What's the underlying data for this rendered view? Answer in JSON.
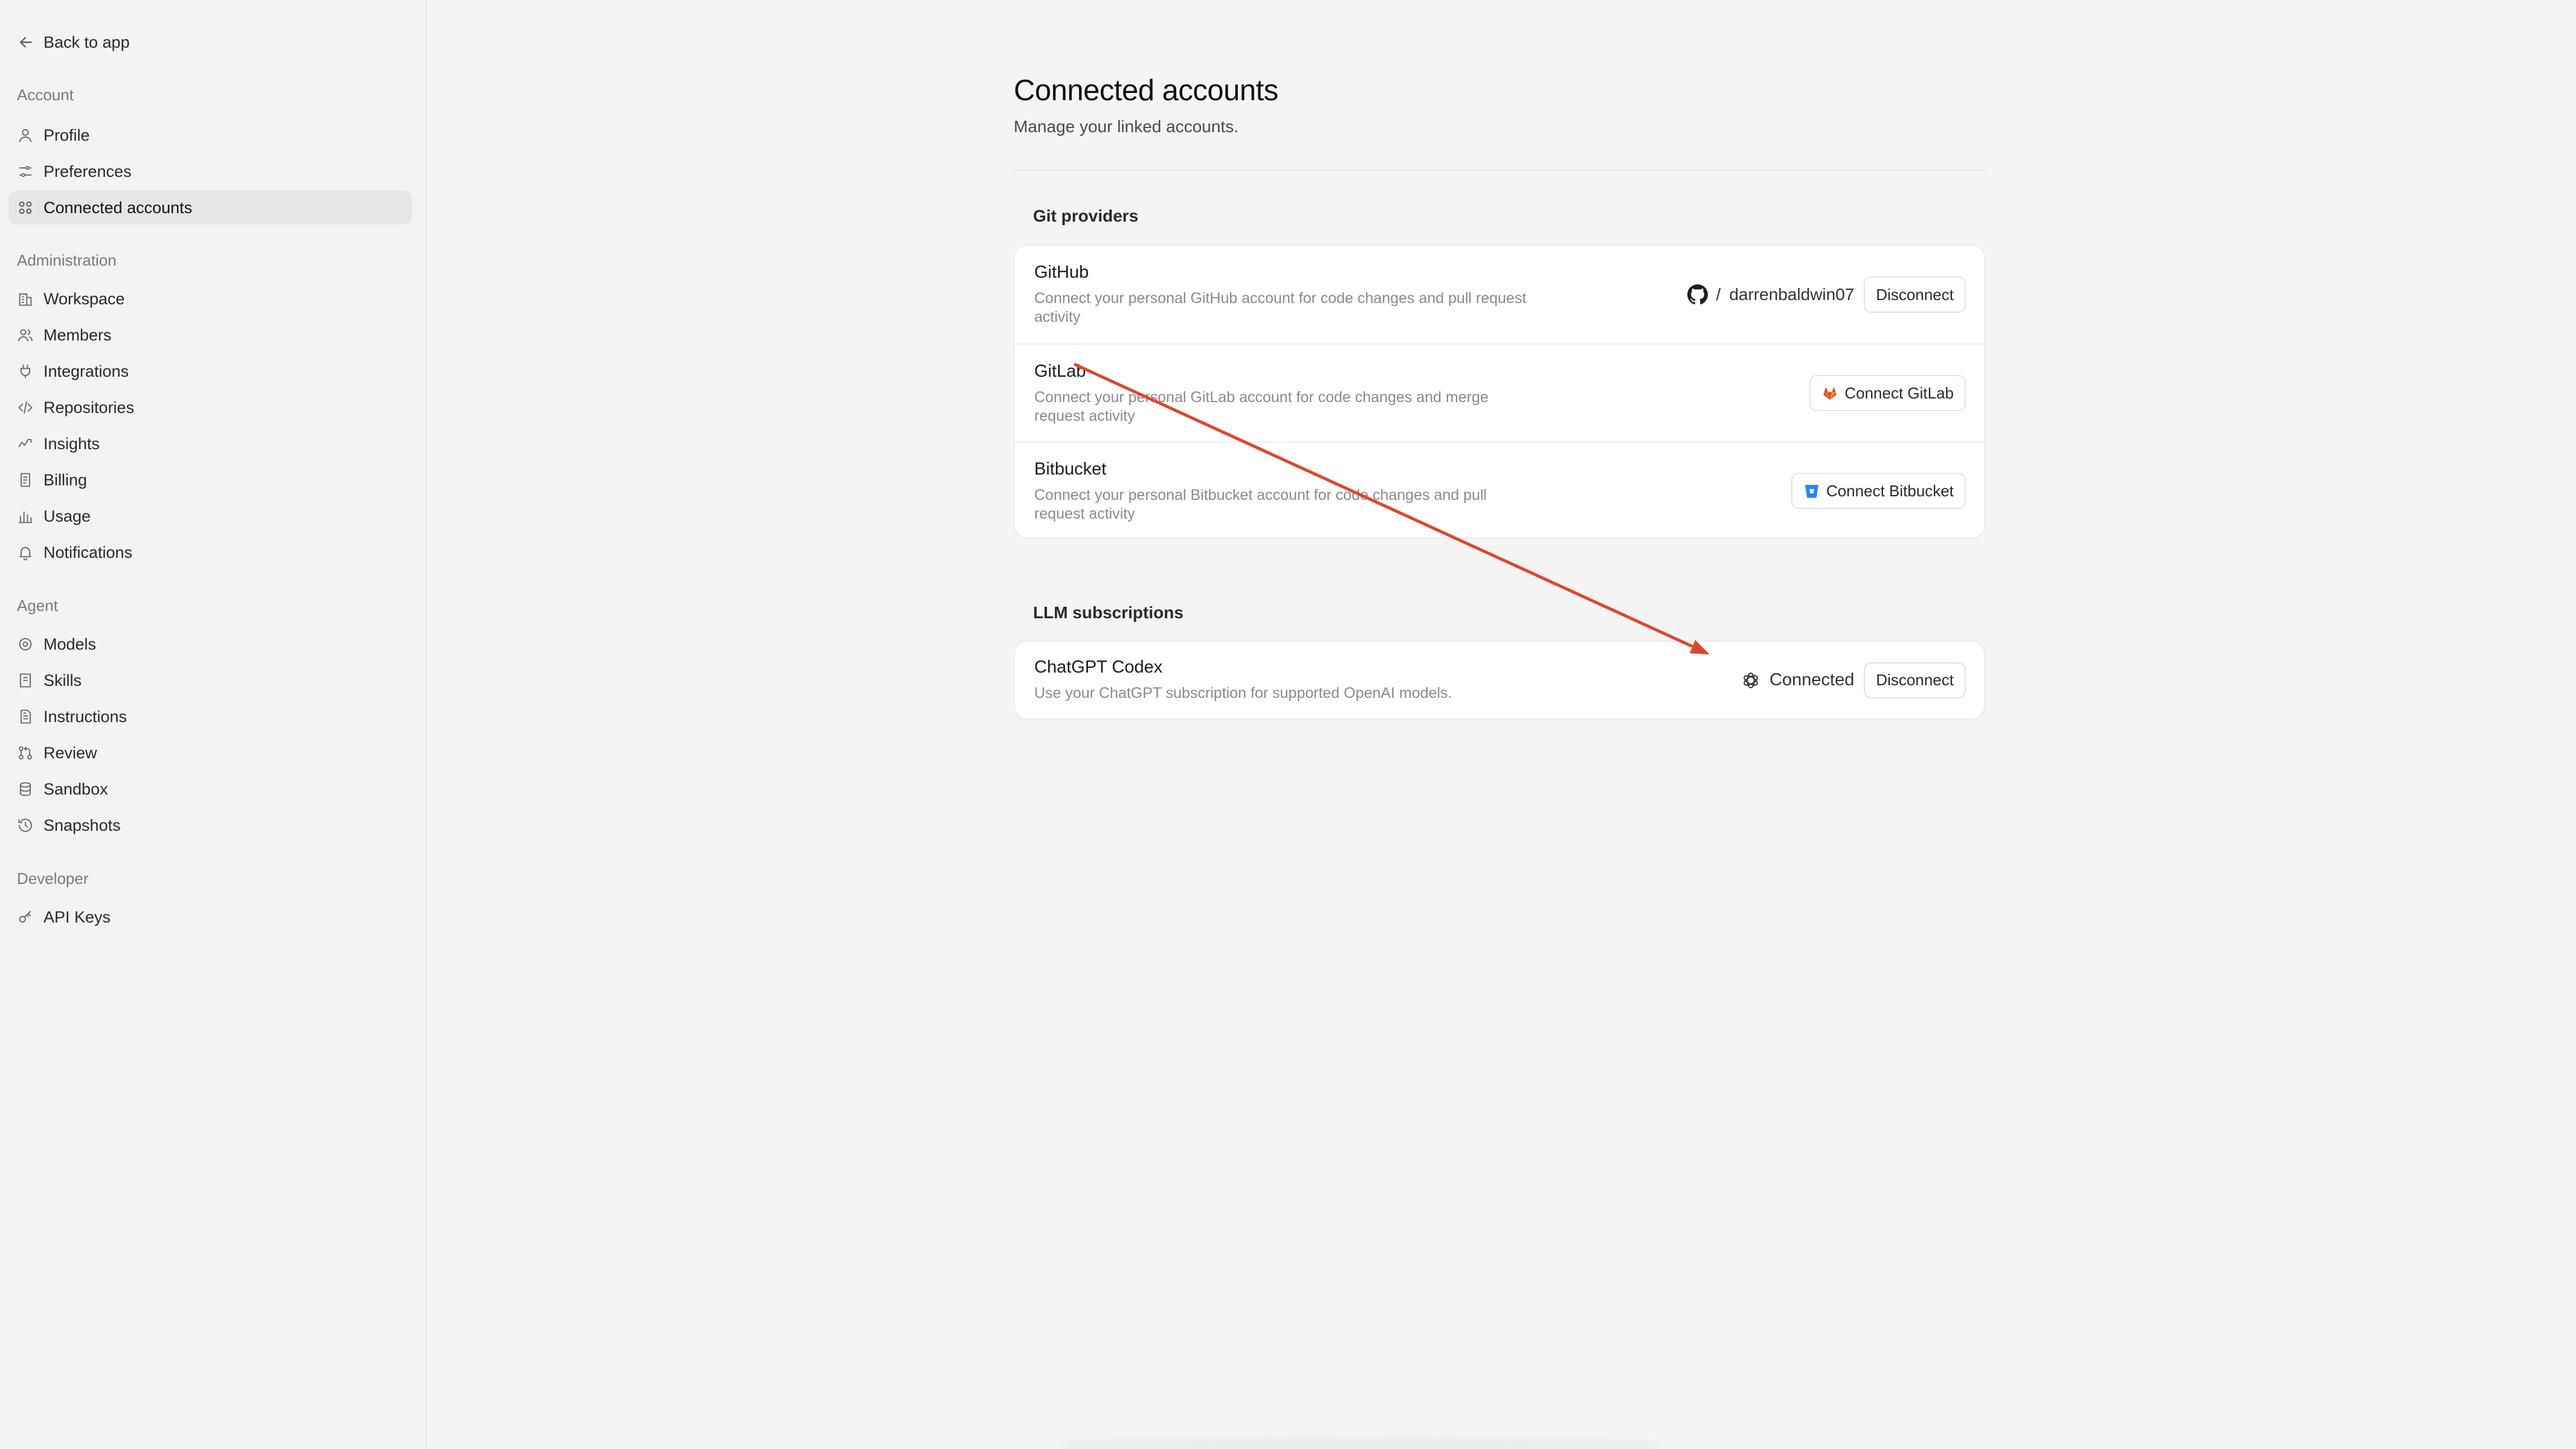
{
  "sidebar": {
    "back_label": "Back to app",
    "sections": [
      {
        "title": "Account",
        "items": [
          {
            "label": "Profile",
            "icon": "user-icon"
          },
          {
            "label": "Preferences",
            "icon": "sliders-icon"
          },
          {
            "label": "Connected accounts",
            "icon": "apps-icon",
            "active": true
          }
        ]
      },
      {
        "title": "Administration",
        "items": [
          {
            "label": "Workspace",
            "icon": "building-icon"
          },
          {
            "label": "Members",
            "icon": "users-icon"
          },
          {
            "label": "Integrations",
            "icon": "plug-icon"
          },
          {
            "label": "Repositories",
            "icon": "code-icon"
          },
          {
            "label": "Insights",
            "icon": "activity-icon"
          },
          {
            "label": "Billing",
            "icon": "receipt-icon"
          },
          {
            "label": "Usage",
            "icon": "bar-chart-icon"
          },
          {
            "label": "Notifications",
            "icon": "bell-icon"
          }
        ]
      },
      {
        "title": "Agent",
        "items": [
          {
            "label": "Models",
            "icon": "cpu-icon"
          },
          {
            "label": "Skills",
            "icon": "book-icon"
          },
          {
            "label": "Instructions",
            "icon": "document-icon"
          },
          {
            "label": "Review",
            "icon": "git-pull-request-icon"
          },
          {
            "label": "Sandbox",
            "icon": "database-icon"
          },
          {
            "label": "Snapshots",
            "icon": "history-icon"
          }
        ]
      },
      {
        "title": "Developer",
        "items": [
          {
            "label": "API Keys",
            "icon": "key-icon"
          }
        ]
      }
    ]
  },
  "main": {
    "title": "Connected accounts",
    "subtitle": "Manage your linked accounts.",
    "git_providers": {
      "title": "Git providers",
      "items": [
        {
          "name": "GitHub",
          "description": "Connect your personal GitHub account for code changes and pull request activity",
          "account_prefix": "/",
          "account": "darrenbaldwin07",
          "action_label": "Disconnect",
          "icon": "github-icon"
        },
        {
          "name": "GitLab",
          "description": "Connect your personal GitLab account for code changes and merge request activity",
          "action_label": "Connect GitLab",
          "icon": "gitlab-icon",
          "brand_color": "#e2432a"
        },
        {
          "name": "Bitbucket",
          "description": "Connect your personal Bitbucket account for code changes and pull request activity",
          "action_label": "Connect Bitbucket",
          "icon": "bitbucket-icon",
          "brand_color": "#2684ff"
        }
      ]
    },
    "llm_subscriptions": {
      "title": "LLM subscriptions",
      "items": [
        {
          "name": "ChatGPT Codex",
          "description": "Use your ChatGPT subscription for supported OpenAI models.",
          "status": "Connected",
          "action_label": "Disconnect",
          "icon": "openai-icon"
        }
      ]
    }
  },
  "annotation": {
    "type": "arrow",
    "color": "#e0452c"
  }
}
